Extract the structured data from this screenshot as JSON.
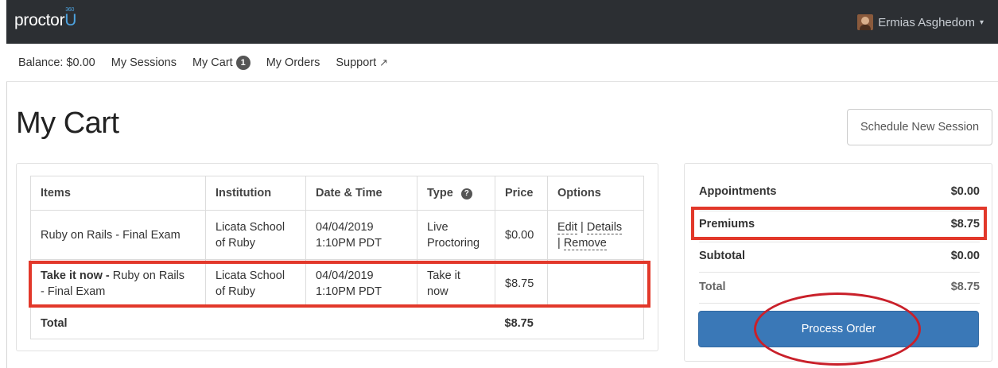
{
  "brand": {
    "logo_main": "proctor",
    "logo_u": "U",
    "logo_cap": "360"
  },
  "user": {
    "name": "Ermias Asghedom",
    "caret": "▾"
  },
  "nav": {
    "balance": "Balance: $0.00",
    "sessions": "My Sessions",
    "cart": "My Cart",
    "cart_count": "1",
    "orders": "My Orders",
    "support": "Support",
    "support_icon": "↗"
  },
  "page": {
    "title": "My Cart",
    "schedule_button": "Schedule New Session"
  },
  "table": {
    "headers": [
      "Items",
      "Institution",
      "Date & Time",
      "Type",
      "Price",
      "Options"
    ],
    "help_icon": "?",
    "rows": [
      {
        "item": "Ruby on Rails - Final Exam",
        "institution_l1": "Licata School",
        "institution_l2": "of Ruby",
        "date": "04/04/2019",
        "time": "1:10PM PDT",
        "type_l1": "Live",
        "type_l2": "Proctoring",
        "price": "$0.00",
        "opt_edit": "Edit",
        "opt_details": "Details",
        "opt_remove": "Remove",
        "sep": "|"
      },
      {
        "item_bold": "Take it now -",
        "item_rest": " Ruby on Rails",
        "item_l2": "- Final Exam",
        "institution_l1": "Licata School",
        "institution_l2": "of Ruby",
        "date": "04/04/2019",
        "time": "1:10PM PDT",
        "type_l1": "Take it",
        "type_l2": "now",
        "price": "$8.75"
      }
    ],
    "total_label": "Total",
    "total_value": "$8.75"
  },
  "summary": {
    "appointments_label": "Appointments",
    "appointments_value": "$0.00",
    "premiums_label": "Premiums",
    "premiums_value": "$8.75",
    "subtotal_label": "Subtotal",
    "subtotal_value": "$0.00",
    "total_label": "Total",
    "total_value": "$8.75",
    "process_button": "Process Order"
  },
  "colors": {
    "topbar": "#2c2f33",
    "brand_u": "#4da3e0",
    "primary_button": "#3a78b7",
    "highlight": "#e2382a"
  }
}
